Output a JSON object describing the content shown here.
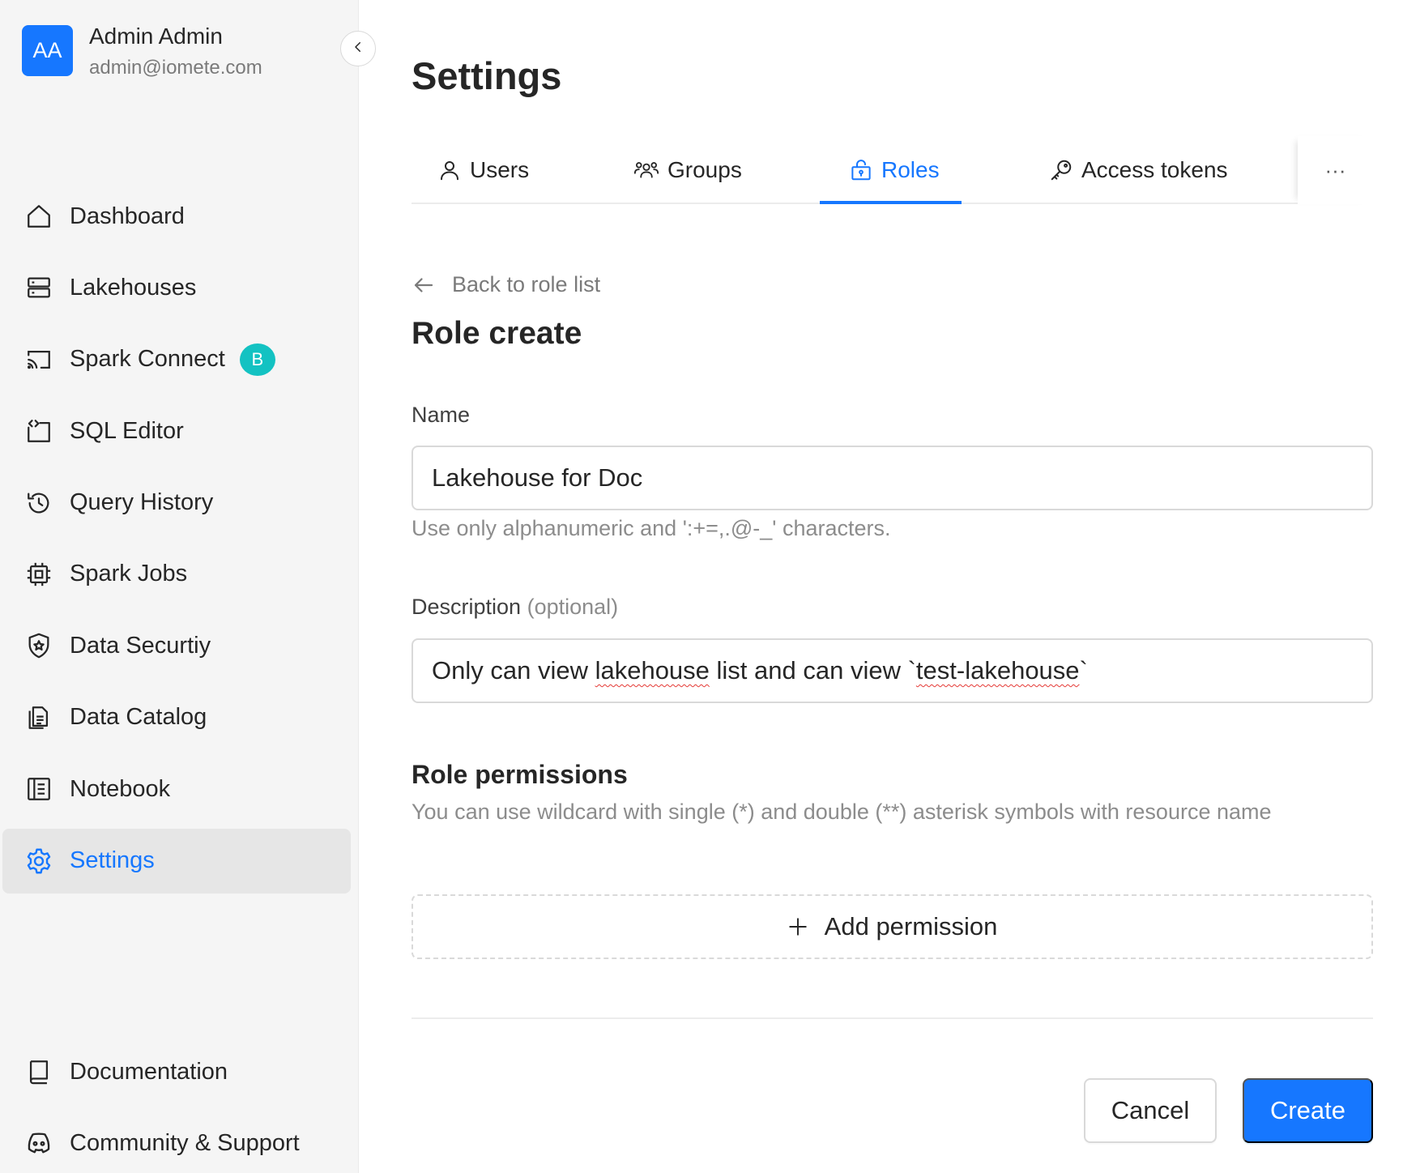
{
  "user": {
    "initials": "AA",
    "name": "Admin Admin",
    "email": "admin@iomete.com"
  },
  "sidebar": {
    "items": [
      {
        "label": "Dashboard",
        "icon": "home-icon"
      },
      {
        "label": "Lakehouses",
        "icon": "server-icon"
      },
      {
        "label": "Spark Connect",
        "icon": "cast-icon",
        "badge": "B"
      },
      {
        "label": "SQL Editor",
        "icon": "code-editor-icon"
      },
      {
        "label": "Query History",
        "icon": "history-icon"
      },
      {
        "label": "Spark Jobs",
        "icon": "chip-icon"
      },
      {
        "label": "Data Securtiy",
        "icon": "shield-icon"
      },
      {
        "label": "Data Catalog",
        "icon": "catalog-icon"
      },
      {
        "label": "Notebook",
        "icon": "notebook-icon"
      },
      {
        "label": "Settings",
        "icon": "gear-icon",
        "active": true
      }
    ],
    "bottom_items": [
      {
        "label": "Documentation",
        "icon": "book-icon"
      },
      {
        "label": "Community & Support",
        "icon": "discord-icon"
      }
    ]
  },
  "page": {
    "title": "Settings"
  },
  "tabs": [
    {
      "label": "Users",
      "icon": "user-icon"
    },
    {
      "label": "Groups",
      "icon": "group-icon"
    },
    {
      "label": "Roles",
      "icon": "lock-icon",
      "active": true
    },
    {
      "label": "Access tokens",
      "icon": "key-icon"
    }
  ],
  "tabs_more": "···",
  "form": {
    "back_label": "Back to role list",
    "title": "Role create",
    "name_label": "Name",
    "name_value": "Lakehouse for Doc",
    "name_help": "Use only alphanumeric and ':+=,.@-_' characters.",
    "description_label": "Description",
    "description_optional": "(optional)",
    "description_parts": [
      "Only can view ",
      "lakehouse",
      " list and can view `",
      "test-lakehouse",
      "`"
    ],
    "permissions_title": "Role permissions",
    "permissions_subtitle": "You can use wildcard with single (*) and double (**) asterisk symbols with resource name",
    "add_permission_label": "Add permission",
    "cancel_label": "Cancel",
    "create_label": "Create"
  },
  "colors": {
    "accent": "#1677ff",
    "badge": "#13c2c2",
    "sidebar_bg": "#f5f5f5",
    "active_bg": "#e6e6e6"
  }
}
